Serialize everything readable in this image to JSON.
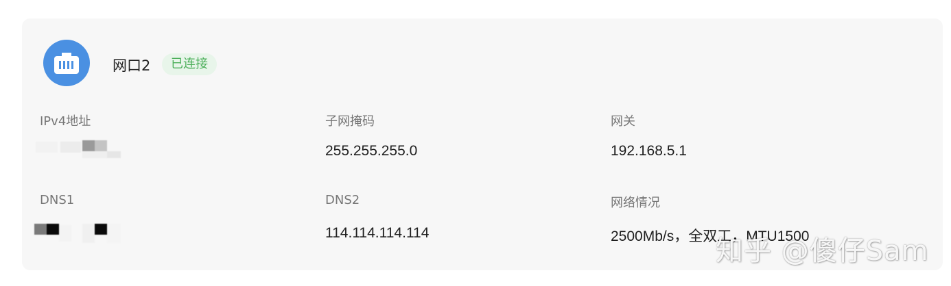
{
  "interface": {
    "name": "网口2",
    "status": "已连接",
    "icon": "ethernet-port-icon",
    "accent": "#4a90e2",
    "status_color": "#4caf5a"
  },
  "fields": {
    "ipv4_label": "IPv4地址",
    "netmask_label": "子网掩码",
    "netmask_value": "255.255.255.0",
    "gateway_label": "网关",
    "gateway_value": "192.168.5.1",
    "dns1_label": "DNS1",
    "dns2_label": "DNS2",
    "dns2_value": "114.114.114.114",
    "network_label": "网络情况",
    "network_value": "2500Mb/s，全双工，MTU1500"
  },
  "watermark": "知乎 @傻仔Sam"
}
